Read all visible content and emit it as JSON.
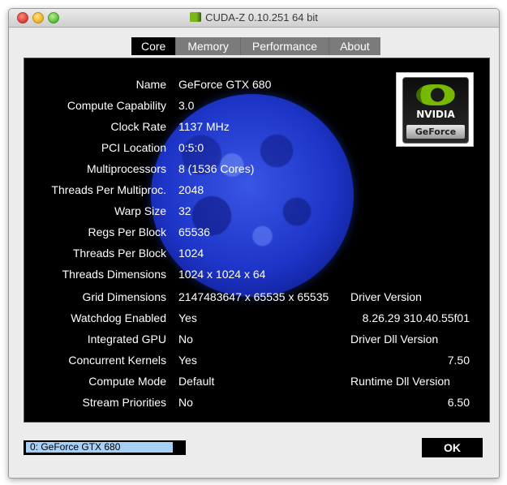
{
  "window": {
    "title": "CUDA-Z 0.10.251 64 bit"
  },
  "tabs": [
    {
      "label": "Core",
      "active": true
    },
    {
      "label": "Memory"
    },
    {
      "label": "Performance"
    },
    {
      "label": "About"
    }
  ],
  "logo": {
    "brand": "NVIDIA",
    "series": "GeForce"
  },
  "core": {
    "rows": [
      {
        "label": "Name",
        "value": "GeForce GTX 680"
      },
      {
        "label": "Compute Capability",
        "value": "3.0"
      },
      {
        "label": "Clock Rate",
        "value": "1137 MHz"
      },
      {
        "label": "PCI Location",
        "value": "0:5:0"
      },
      {
        "label": "Multiprocessors",
        "value": "8 (1536 Cores)"
      },
      {
        "label": "Threads Per Multiproc.",
        "value": "2048"
      },
      {
        "label": "Warp Size",
        "value": "32"
      },
      {
        "label": "Regs Per Block",
        "value": "65536"
      },
      {
        "label": "Threads Per Block",
        "value": "1024"
      },
      {
        "label": "Threads Dimensions",
        "value": "1024 x 1024 x 64"
      },
      {
        "label": "Grid Dimensions",
        "value": "2147483647 x 65535 x 65535"
      },
      {
        "label": "Watchdog Enabled",
        "value": "Yes"
      },
      {
        "label": "Integrated GPU",
        "value": "No"
      },
      {
        "label": "Concurrent Kernels",
        "value": "Yes"
      },
      {
        "label": "Compute Mode",
        "value": "Default"
      },
      {
        "label": "Stream Priorities",
        "value": "No"
      }
    ],
    "driver": {
      "driver_version_label": "Driver Version",
      "driver_version": "8.26.29 310.40.55f01",
      "driver_dll_label": "Driver Dll Version",
      "driver_dll_version": "7.50",
      "runtime_dll_label": "Runtime Dll Version",
      "runtime_dll_version": "6.50"
    }
  },
  "footer": {
    "device": "0: GeForce GTX 680",
    "ok_label": "OK"
  },
  "colors": {
    "panel_bg": "#000000",
    "tab_active_bg": "#000000",
    "tab_inactive_bg": "#7b7b7b",
    "moon": "#2a44d8",
    "selection": "#a8d0f5"
  }
}
